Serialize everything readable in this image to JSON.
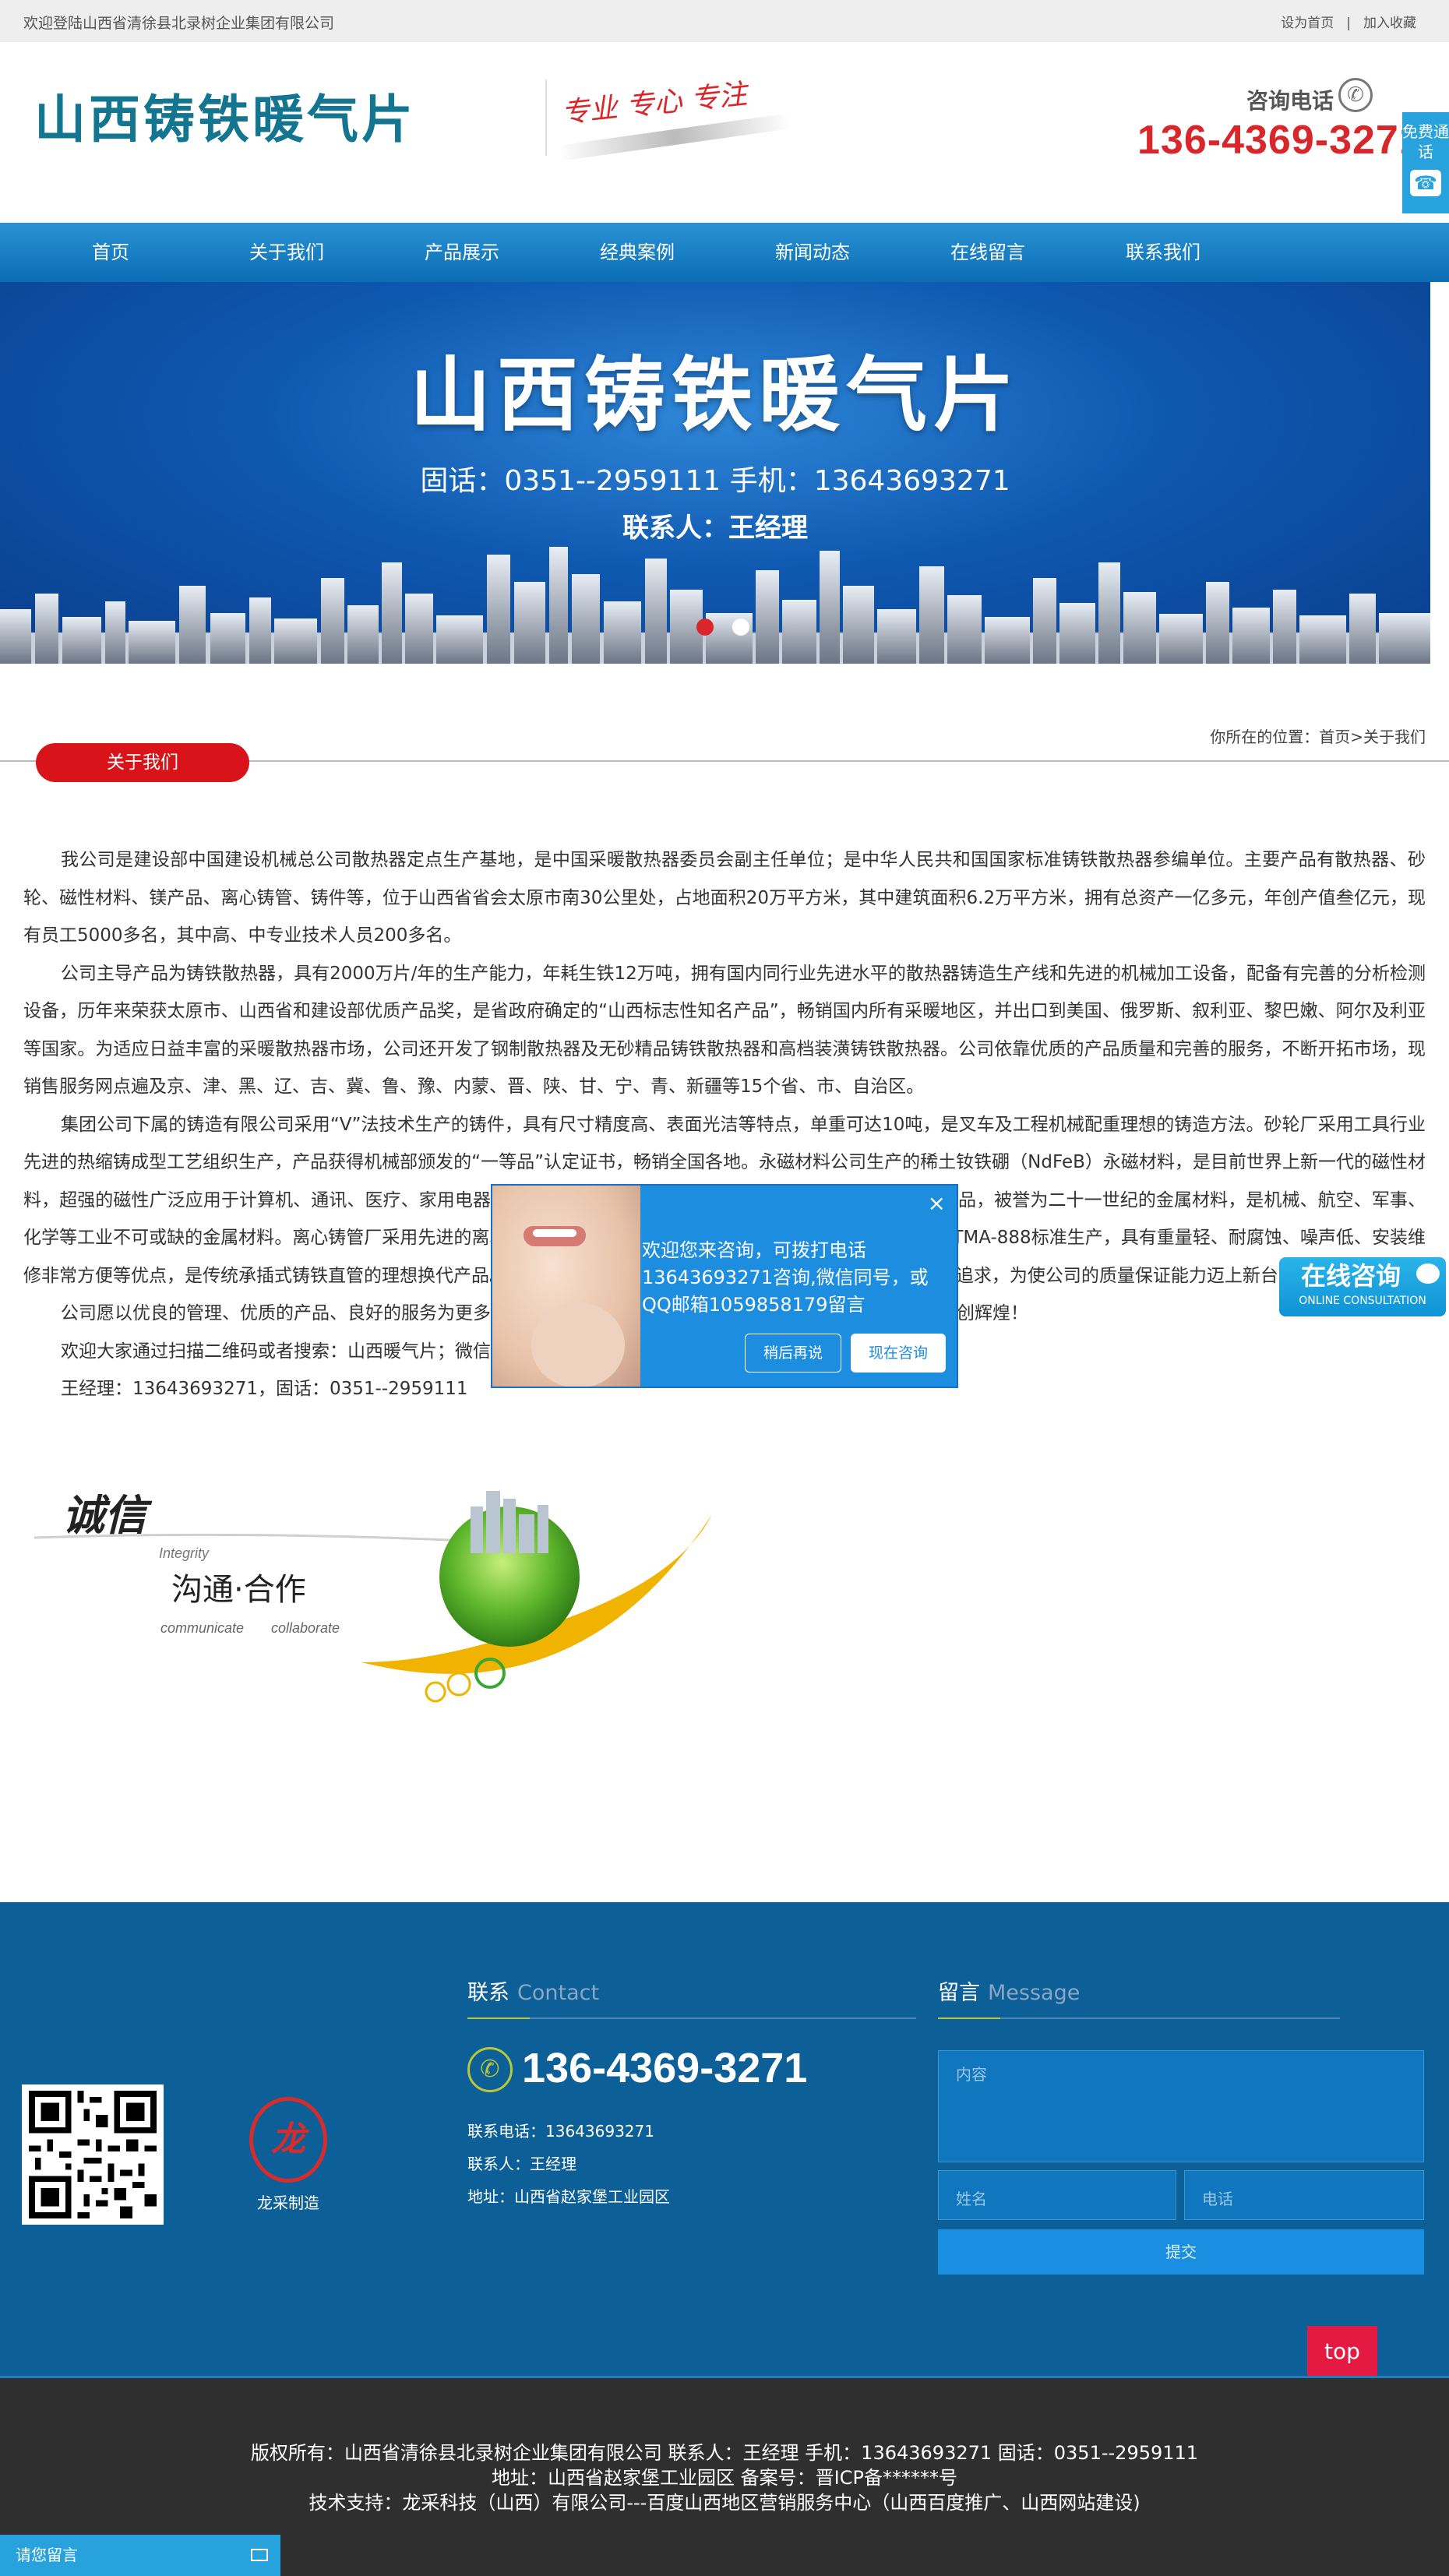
{
  "topbar": {
    "welcome": "欢迎登陆山西省清徐县北录树企业集团有限公司",
    "set_home": "设为首页",
    "separator": "|",
    "add_fav": "加入收藏"
  },
  "header": {
    "logo": "山西铸铁暖气片",
    "slogan": "专业 专心 专注",
    "consult_label": "咨询电话",
    "phone": "136-4369-3271",
    "free_call": "免费通话"
  },
  "nav": {
    "items": [
      "首页",
      "关于我们",
      "产品展示",
      "经典案例",
      "新闻动态",
      "在线留言",
      "联系我们"
    ]
  },
  "banner": {
    "title": "山西铸铁暖气片",
    "phone_line": "固话：0351--2959111   手机：13643693271",
    "contact_line": "联系人：王经理"
  },
  "section": {
    "tab": "关于我们",
    "breadcrumb": "你所在的位置：首页>关于我们"
  },
  "content": {
    "paragraphs": [
      "我公司是建设部中国建设机械总公司散热器定点生产基地，是中国采暖散热器委员会副主任单位；是中华人民共和国国家标准铸铁散热器参编单位。主要产品有散热器、砂轮、磁性材料、镁产品、离心铸管、铸件等，位于山西省省会太原市南30公里处，占地面积20万平方米，其中建筑面积6.2万平方米，拥有总资产一亿多元，年创产值叁亿元，现有员工5000多名，其中高、中专业技术人员200多名。",
      "公司主导产品为铸铁散热器，具有2000万片/年的生产能力，年耗生铁12万吨，拥有国内同行业先进水平的散热器铸造生产线和先进的机械加工设备，配备有完善的分析检测设备，历年来荣获太原市、山西省和建设部优质产品奖，是省政府确定的“山西标志性知名产品”，畅销国内所有采暖地区，并出口到美国、俄罗斯、叙利亚、黎巴嫩、阿尔及利亚等国家。为适应日益丰富的采暖散热器市场，公司还开发了钢制散热器及无砂精品铸铁散热器和高档装潢铸铁散热器。公司依靠优质的产品质量和完善的服务，不断开拓市场，现销售服务网点遍及京、津、黑、辽、吉、冀、鲁、豫、内蒙、晋、陕、甘、宁、青、新疆等15个省、市、自治区。",
      "集团公司下属的铸造有限公司采用“V”法技术生产的铸件，具有尺寸精度高、表面光洁等特点，单重可达10吨，是叉车及工程机械配重理想的铸造方法。砂轮厂采用工具行业先进的热缩铸成型工艺组织生产，产品获得机械部颁发的“一等品”认定证书，畅销全国各地。永磁材料公司生产的稀土钕铁硼（NdFeB）永磁材料，是目前世界上新一代的磁性材料，超强的磁性广泛应用于计算机、通讯、医疗、家用电器、汽车等行业。镁产品公司生产的高纯镁锭及镁合金系列产品，被誉为二十一世纪的金属材料，是机械、航空、军事、化学等工业不可或缺的金属材料。离心铸管厂采用先进的离心铸造工艺，按国家标准GB/T12772-1999及美国标准ASTMA-888标准生产，具有重量轻、耐腐蚀、噪声低、安装维修非常方便等优点，是传统承插式铸铁直管的理想换代产品。公司以“诚信为本、质量第一”为宗旨，全体员工以不懈的追求，为使公司的质量保证能力迈上新台阶。",
      "公司愿以优良的管理、优质的产品、良好的服务为更多的客户提供满意的产品和服务，愿与各界朋友真诚合作，共创辉煌！",
      "欢迎大家通过扫描二维码或者搜索：山西暖气片；微信公众平台关注我们。",
      "王经理：13643693271，固话：0351--2959111"
    ],
    "integrity": {
      "title": "诚信",
      "title_en": "Integrity",
      "subtitle": "沟通·合作",
      "en1": "communicate",
      "en2": "collaborate"
    }
  },
  "popup": {
    "message": "欢迎您来咨询，可拨打电话13643693271咨询,微信同号，或QQ邮箱1059858179留言",
    "later": "稍后再说",
    "now": "现在咨询",
    "close": "×"
  },
  "consult_float": {
    "cn": "在线咨询",
    "en": "ONLINE CONSULTATION"
  },
  "footer": {
    "brand_name": "龙采制造",
    "contact_head": "联系",
    "contact_head_en": "Contact",
    "phone": "136-4369-3271",
    "tel_line": "联系电话：13643693271",
    "person_line": "联系人：王经理",
    "address_line": "地址：山西省赵家堡工业园区",
    "message_head": "留言",
    "message_head_en": "Message",
    "content_placeholder": "内容",
    "name_placeholder": "姓名",
    "phone_placeholder": "电话",
    "submit": "提交",
    "top": "top"
  },
  "copyright": {
    "line1": "版权所有：山西省清徐县北录树企业集团有限公司 联系人：王经理   手机：13643693271   固话：0351--2959111",
    "line2": "地址：山西省赵家堡工业园区 备案号：晋ICP备******号",
    "line3": "技术支持：龙采科技（山西）有限公司---百度山西地区营销服务中心（山西百度推广、山西网站建设)"
  },
  "leave_message": "请您留言",
  "colors": {
    "brand_blue": "#13758f",
    "nav_blue": "#0b6db4",
    "accent_red": "#d8262a",
    "footer_blue": "#0d5f97"
  }
}
